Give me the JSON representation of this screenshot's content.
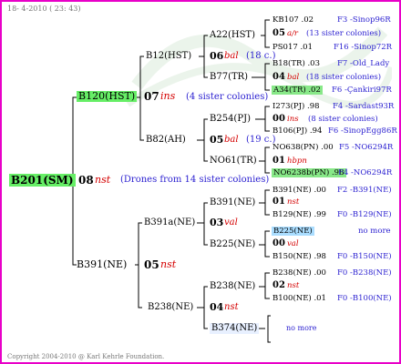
{
  "header": {
    "date": "18- 4-2010 ( 23: 43)"
  },
  "footer": {
    "copyright": "Copyright 2004-2010 @ Karl Kehrle Foundation."
  },
  "root": {
    "name": "B201(SM)",
    "gen": "08",
    "breed": "nst",
    "drones": "(Drones from 14 sister colonies)"
  },
  "l1": [
    {
      "name": "B120(HST)",
      "gen": "07",
      "breed": "ins",
      "note": "(4 sister colonies)"
    },
    {
      "name": "B391(NE)",
      "gen": "05",
      "breed": "nst",
      "note": ""
    }
  ],
  "l2": [
    {
      "name": "B12(HST)",
      "gen": "06",
      "breed": "bal",
      "note": "(18 c.)"
    },
    {
      "name": "B82(AH)",
      "gen": "05",
      "breed": "bal",
      "note": "(19 c.)"
    },
    {
      "name": "B391a(NE)",
      "gen": "03",
      "breed": "val",
      "note": ""
    },
    {
      "name": "B238(NE)",
      "gen": "04",
      "breed": "nst",
      "note": ""
    }
  ],
  "l3": [
    {
      "name": "A22(HST)"
    },
    {
      "name": "B77(TR)"
    },
    {
      "name": "B254(PJ)"
    },
    {
      "name": "NO61(TR)"
    },
    {
      "name": "B391(NE)"
    },
    {
      "name": "B225(NE)"
    },
    {
      "name": "B238(NE)"
    },
    {
      "name": "B374(NE)"
    }
  ],
  "l4": [
    {
      "top": "KB107 .02",
      "top_link": "F3 -Sinop96R",
      "gen": "05",
      "breed": "a/r",
      "note": "(13 sister colonies)",
      "bot": "PS017 .01",
      "bot_link": "F16 -Sinop72R"
    },
    {
      "top": "B18(TR) .03",
      "top_link": "F7 -Old_Lady",
      "gen": "04",
      "breed": "bal",
      "note": "(18 sister colonies)",
      "bot": "A34(TR) .02",
      "bot_link": "F6 -Çankiri97R"
    },
    {
      "top": "I273(PJ) .98",
      "top_link": "F4 -Sardast93R",
      "gen": "00",
      "breed": "ins",
      "note": "(8 sister colonies)",
      "bot": "B106(PJ) .94",
      "bot_link": "F6 -SinopEgg86R"
    },
    {
      "top": "NO638(PN) .00",
      "top_link": "F5 -NO6294R",
      "gen": "01",
      "breed": "hbpn",
      "note": "",
      "bot": "NO6238b(PN) .98",
      "bot_link": "F4 -NO6294R"
    },
    {
      "top": "B391(NE) .00",
      "top_link": "F2 -B391(NE)",
      "gen": "01",
      "breed": "nst",
      "note": "",
      "bot": "B129(NE) .99",
      "bot_link": "F0 -B129(NE)"
    },
    {
      "top": "B225(NE)",
      "top_link": "no more",
      "gen": "00",
      "breed": "val",
      "note": "",
      "bot": "B150(NE) .98",
      "bot_link": "F0 -B150(NE)"
    },
    {
      "top": "B238(NE) .00",
      "top_link": "F0 -B238(NE)",
      "gen": "02",
      "breed": "nst",
      "note": "",
      "bot": "B100(NE) .01",
      "bot_link": "F0 -B100(NE)"
    },
    {
      "nomore": "no more"
    }
  ]
}
